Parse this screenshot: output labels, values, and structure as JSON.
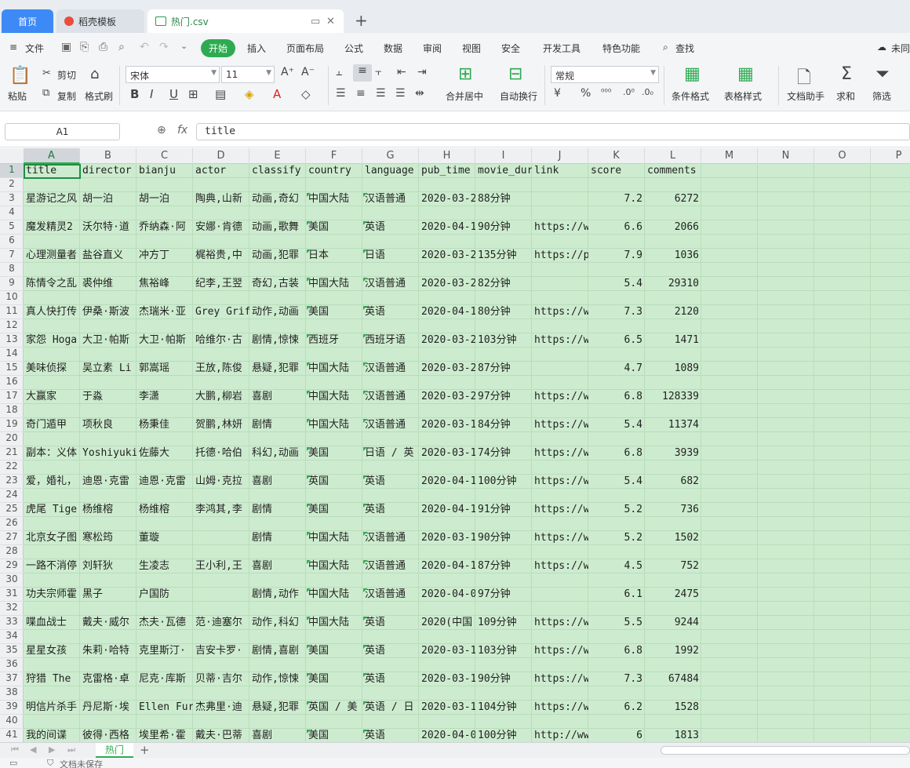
{
  "tabs": {
    "home": "首页",
    "template": "稻壳模板",
    "file": "热门.csv",
    "new_tab": "+"
  },
  "menu": {
    "file": "文件",
    "items": [
      "开始",
      "插入",
      "页面布局",
      "公式",
      "数据",
      "审阅",
      "视图",
      "安全",
      "开发工具",
      "特色功能"
    ],
    "search": "查找",
    "cloud": "未同"
  },
  "ribbon": {
    "paste": "粘贴",
    "cut": "剪切",
    "copy": "复制",
    "format_painter": "格式刷",
    "font_name": "宋体",
    "font_size": "11",
    "bold": "B",
    "italic": "I",
    "underline": "U",
    "merge": "合并居中",
    "wrap": "自动换行",
    "number_format": "常规",
    "currency": "¥",
    "percent": "%",
    "cond_format": "条件格式",
    "table_style": "表格样式",
    "doc_helper": "文档助手",
    "sum": "求和",
    "filter": "筛选"
  },
  "formula": {
    "cell_ref": "A1",
    "fx": "fx",
    "value": "title"
  },
  "columns": [
    "A",
    "B",
    "C",
    "D",
    "E",
    "F",
    "G",
    "H",
    "I",
    "J",
    "K",
    "L",
    "M",
    "N",
    "O",
    "P"
  ],
  "rows": [
    "1",
    "2",
    "3",
    "4",
    "5",
    "6",
    "7",
    "8",
    "9",
    "10",
    "11",
    "12",
    "13",
    "14",
    "15",
    "16",
    "17",
    "18",
    "19",
    "20",
    "21",
    "22",
    "23",
    "24",
    "25",
    "26",
    "27",
    "28",
    "29",
    "30",
    "31",
    "32",
    "33",
    "34",
    "35",
    "36",
    "37",
    "38",
    "39",
    "40",
    "41"
  ],
  "header_row": [
    "title",
    "director",
    "bianju",
    "actor",
    "classify",
    "country",
    "language",
    "pub_time",
    "movie_dur",
    "link",
    "score",
    "comments"
  ],
  "data_rows": [
    [
      "星游记之风",
      "胡一泊",
      "胡一泊",
      "陶典,山新",
      "动画,奇幻",
      "中国大陆",
      "汉语普通",
      "2020-03-2",
      "88分钟",
      "",
      "7.2",
      "6272"
    ],
    [
      "魔发精灵2",
      "沃尔特·道",
      "乔纳森·阿",
      "安娜·肯德",
      "动画,歌舞",
      "美国",
      "英语",
      "2020-04-1",
      "90分钟",
      "https://w",
      "6.6",
      "2066"
    ],
    [
      "心理测量者",
      "盐谷直义",
      "冲方丁",
      "梶裕贵,中",
      "动画,犯罪",
      "日本",
      "日语",
      "2020-03-2",
      "135分钟",
      "https://p",
      "7.9",
      "1036"
    ],
    [
      "陈情令之乱",
      "裘仲维",
      "焦裕峰",
      "纪李,王翌",
      "奇幻,古装",
      "中国大陆",
      "汉语普通",
      "2020-03-2",
      "82分钟",
      "",
      "5.4",
      "29310"
    ],
    [
      "真人快打传",
      "伊桑·斯波",
      "杰瑞米·亚",
      "Grey Grif",
      "动作,动画",
      "美国",
      "英语",
      "2020-04-1",
      "80分钟",
      "https://w",
      "7.3",
      "2120"
    ],
    [
      "家怨 Hoga",
      "大卫·帕斯",
      "大卫·帕斯",
      "哈维尔·古",
      "剧情,惊悚",
      "西班牙",
      "西班牙语",
      "2020-03-2",
      "103分钟",
      "https://w",
      "6.5",
      "1471"
    ],
    [
      "美味侦探",
      "吴立素 Li",
      "郭嵩瑶",
      "王放,陈俊",
      "悬疑,犯罪",
      "中国大陆",
      "汉语普通",
      "2020-03-2",
      "87分钟",
      "",
      "4.7",
      "1089"
    ],
    [
      "大赢家",
      "于淼",
      "李潇",
      "大鹏,柳岩",
      "喜剧",
      "中国大陆",
      "汉语普通",
      "2020-03-2",
      "97分钟",
      "https://w",
      "6.8",
      "128339"
    ],
    [
      "奇门遁甲",
      "项秋良",
      "杨秉佳",
      "贺鹏,林妍",
      "剧情",
      "中国大陆",
      "汉语普通",
      "2020-03-1",
      "84分钟",
      "https://w",
      "5.4",
      "11374"
    ],
    [
      "副本：义体",
      "Yoshiyuki",
      "佐藤大",
      "托德·哈伯",
      "科幻,动画",
      "美国",
      "日语 / 英",
      "2020-03-1",
      "74分钟",
      "https://w",
      "6.8",
      "3939"
    ],
    [
      "爱，婚礼，",
      "迪恩·克雷",
      "迪恩·克雷",
      "山姆·克拉",
      "喜剧",
      "英国",
      "英语",
      "2020-04-1",
      "100分钟",
      "https://w",
      "5.4",
      "682"
    ],
    [
      "虎尾 Tige",
      "杨维榕",
      "杨维榕",
      "李鸿其,李",
      "剧情",
      "美国",
      "英语",
      "2020-04-1",
      "91分钟",
      "https://w",
      "5.2",
      "736"
    ],
    [
      "北京女子图",
      "寒松筠",
      "董璇",
      "",
      "剧情",
      "中国大陆",
      "汉语普通",
      "2020-03-1",
      "90分钟",
      "https://w",
      "5.2",
      "1502"
    ],
    [
      "一路不消停",
      "刘轩狄",
      "生凌志",
      "王小利,王",
      "喜剧",
      "中国大陆",
      "汉语普通",
      "2020-04-1",
      "87分钟",
      "https://w",
      "4.5",
      "752"
    ],
    [
      "功夫宗师霍",
      "黑子",
      "户国防",
      "",
      "剧情,动作",
      "中国大陆",
      "汉语普通",
      "2020-04-0",
      "97分钟",
      "",
      "6.1",
      "2475"
    ],
    [
      "喋血战士",
      "戴夫·威尔",
      "杰夫·瓦德",
      "范·迪塞尔",
      "动作,科幻",
      "中国大陆",
      "英语",
      "2020(中国",
      "109分钟",
      "https://w",
      "5.5",
      "9244"
    ],
    [
      "星星女孩",
      "朱莉·哈特",
      "克里斯汀·",
      "吉安卡罗·",
      "剧情,喜剧",
      "美国",
      "英语",
      "2020-03-1",
      "103分钟",
      "https://w",
      "6.8",
      "1992"
    ],
    [
      "狩猎 The",
      "克雷格·卓",
      "尼克·库斯",
      "贝蒂·吉尔",
      "动作,惊悚",
      "美国",
      "英语",
      "2020-03-1",
      "90分钟",
      "https://w",
      "7.3",
      "67484"
    ],
    [
      "明信片杀手",
      "丹尼斯·埃",
      "Ellen Fur",
      "杰弗里·迪",
      "悬疑,犯罪",
      "英国 / 美",
      "英语 / 日",
      "2020-03-1",
      "104分钟",
      "https://w",
      "6.2",
      "1528"
    ],
    [
      "我的间谍",
      "彼得·西格",
      "埃里希·霍",
      "戴夫·巴蒂",
      "喜剧",
      "美国",
      "英语",
      "2020-04-0",
      "100分钟",
      "http://ww",
      "6",
      "1813"
    ]
  ],
  "sheet": {
    "name": "热门",
    "add": "+"
  },
  "status": {
    "save": "文档未保存"
  }
}
